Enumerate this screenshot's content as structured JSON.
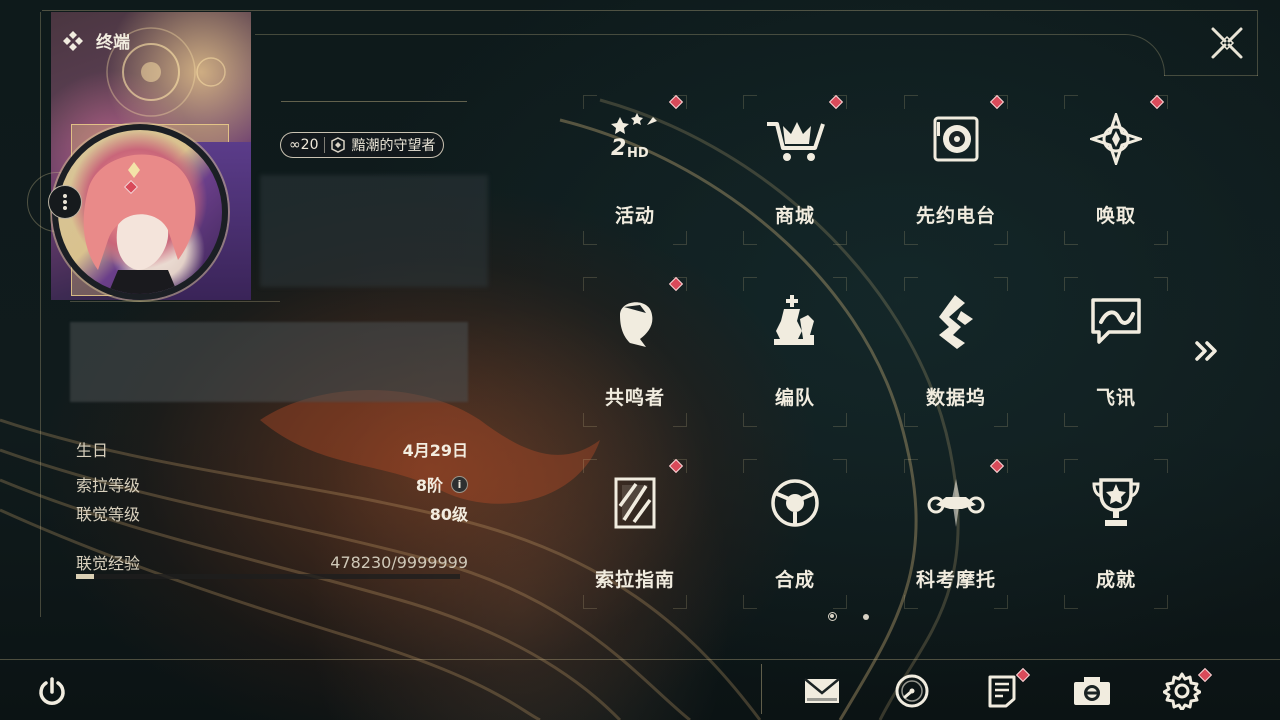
{
  "header": {
    "title": "终端"
  },
  "profile": {
    "level_badge": "∞20",
    "title_badge": "黯潮的守望者",
    "stats": [
      {
        "label": "生日",
        "value": "4月29日"
      },
      {
        "label": "索拉等级",
        "value": "8阶"
      },
      {
        "label": "联觉等级",
        "value": "80级"
      },
      {
        "label": "联觉经验",
        "value": "478230/9999999"
      }
    ],
    "exp_progress": 0.048
  },
  "menu": {
    "items": [
      {
        "label": "活动",
        "icon": "event-2hd-icon",
        "notify": true
      },
      {
        "label": "商城",
        "icon": "shop-cart-icon",
        "notify": true
      },
      {
        "label": "先约电台",
        "icon": "radio-icon",
        "notify": true
      },
      {
        "label": "唤取",
        "icon": "convene-compass-icon",
        "notify": true
      },
      {
        "label": "共鸣者",
        "icon": "resonator-head-icon",
        "notify": true
      },
      {
        "label": "编队",
        "icon": "chess-team-icon",
        "notify": false
      },
      {
        "label": "数据坞",
        "icon": "data-dock-icon",
        "notify": false
      },
      {
        "label": "飞讯",
        "icon": "message-bubble-icon",
        "notify": false
      },
      {
        "label": "索拉指南",
        "icon": "guide-book-icon",
        "notify": true
      },
      {
        "label": "合成",
        "icon": "synthesis-icon",
        "notify": false
      },
      {
        "label": "科考摩托",
        "icon": "motorcycle-icon",
        "notify": true
      },
      {
        "label": "成就",
        "icon": "trophy-icon",
        "notify": false
      }
    ]
  },
  "pager": {
    "current": 1,
    "total": 2
  },
  "bottom_bar": [
    {
      "name": "mail",
      "icon": "mail-icon",
      "notify": false
    },
    {
      "name": "clock",
      "icon": "clock-icon",
      "notify": false
    },
    {
      "name": "notes",
      "icon": "notes-icon",
      "notify": true
    },
    {
      "name": "camera",
      "icon": "camera-icon",
      "notify": false
    },
    {
      "name": "settings",
      "icon": "gear-icon",
      "notify": true
    }
  ],
  "colors": {
    "accent": "#d94a5a",
    "text": "#f1ecdf",
    "gold": "#c8b98c"
  }
}
